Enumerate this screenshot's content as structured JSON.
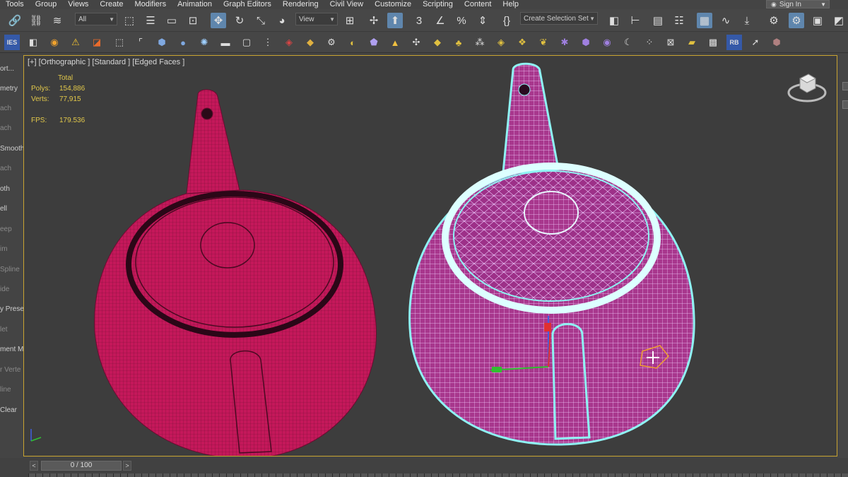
{
  "menu": [
    "Tools",
    "Group",
    "Views",
    "Create",
    "Modifiers",
    "Animation",
    "Graph Editors",
    "Rendering",
    "Civil View",
    "Customize",
    "Scripting",
    "Content",
    "Help"
  ],
  "signin": "Sign In",
  "toolbar": {
    "filter_value": "All",
    "ref_coord_value": "View",
    "selection_set_placeholder": "Create Selection Set",
    "snap_label": "3"
  },
  "command_panel_items": [
    {
      "label": "ort...",
      "dim": false
    },
    {
      "label": "metry",
      "dim": false
    },
    {
      "label": "ach",
      "dim": true
    },
    {
      "label": "ach",
      "dim": true
    },
    {
      "label": "Smooth",
      "dim": false
    },
    {
      "label": "ach",
      "dim": true
    },
    {
      "label": "oth",
      "dim": false
    },
    {
      "label": "ell",
      "dim": false
    },
    {
      "label": "eep",
      "dim": true
    },
    {
      "label": "im",
      "dim": true
    },
    {
      "label": "Spline",
      "dim": true
    },
    {
      "label": "ide",
      "dim": true
    },
    {
      "label": "y Preset",
      "dim": false
    },
    {
      "label": "let",
      "dim": true
    },
    {
      "label": "ment Mo",
      "dim": false
    },
    {
      "label": "r Verte",
      "dim": true
    },
    {
      "label": "line",
      "dim": true
    },
    {
      "label": "Clear",
      "dim": false
    }
  ],
  "viewport": {
    "label": "[+] [Orthographic ] [Standard ] [Edged Faces ]",
    "stats_header": "Total",
    "polys_label": "Polys:",
    "polys_value": "154,886",
    "verts_label": "Verts:",
    "verts_value": "77,915",
    "fps_label": "FPS:",
    "fps_value": "179.536"
  },
  "timeline": {
    "frame": "0 / 100",
    "prev": "<",
    "next": ">"
  },
  "colors": {
    "mesh_magenta": "#c2185b",
    "mesh_pink": "#b03a8f",
    "selection_cyan": "#8ff3f3",
    "viewport_border": "#c9a431",
    "stats_yellow": "#e2c84a",
    "active_button": "#5f86ad"
  }
}
